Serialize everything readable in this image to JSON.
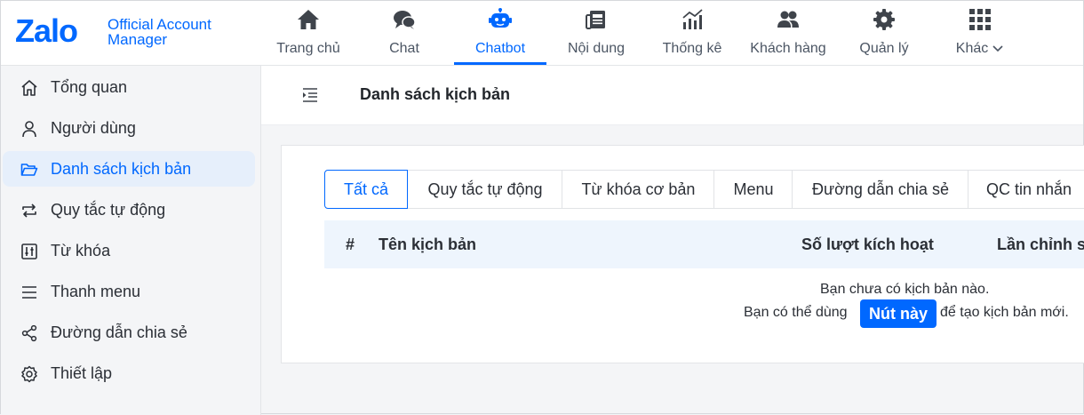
{
  "brand": {
    "logo_word": "Zalo",
    "subtitle_line1": "Official Account",
    "subtitle_line2": "Manager",
    "accent_color": "#0068ff"
  },
  "nav": {
    "items": [
      {
        "label": "Trang chủ",
        "icon": "home-icon"
      },
      {
        "label": "Chat",
        "icon": "chat-bubbles-icon"
      },
      {
        "label": "Chatbot",
        "icon": "robot-icon",
        "active": true
      },
      {
        "label": "Nội dung",
        "icon": "newspaper-icon"
      },
      {
        "label": "Thống kê",
        "icon": "bar-chart-icon"
      },
      {
        "label": "Khách hàng",
        "icon": "users-icon"
      },
      {
        "label": "Quản lý",
        "icon": "gear-icon"
      },
      {
        "label": "Khác",
        "icon": "grid-icon",
        "has_dropdown": true
      }
    ]
  },
  "sidebar": {
    "items": [
      {
        "label": "Tổng quan",
        "icon": "home-outline-icon"
      },
      {
        "label": "Người dùng",
        "icon": "user-outline-icon"
      },
      {
        "label": "Danh sách kịch bản",
        "icon": "folder-open-icon",
        "active": true
      },
      {
        "label": "Quy tắc tự động",
        "icon": "repeat-icon"
      },
      {
        "label": "Từ khóa",
        "icon": "sliders-icon"
      },
      {
        "label": "Thanh menu",
        "icon": "menu-lines-icon"
      },
      {
        "label": "Đường dẫn chia sẻ",
        "icon": "share-icon"
      },
      {
        "label": "Thiết lập",
        "icon": "settings-outline-icon"
      }
    ]
  },
  "main": {
    "title": "Danh sách kịch bản",
    "tabs": [
      {
        "label": "Tất cả",
        "active": true
      },
      {
        "label": "Quy tắc tự động"
      },
      {
        "label": "Từ khóa cơ bản"
      },
      {
        "label": "Menu"
      },
      {
        "label": "Đường dẫn chia sẻ"
      },
      {
        "label": "QC tin nhắn"
      }
    ],
    "table": {
      "columns": [
        "#",
        "Tên kịch bản",
        "Số lượt kích hoạt",
        "Lần chỉnh s"
      ]
    },
    "empty": {
      "line1": "Bạn chưa có kịch bản nào.",
      "line2_before": "Bạn có thể dùng",
      "button_label": "Nút này",
      "line2_after": "để tạo kịch bản mới."
    }
  }
}
